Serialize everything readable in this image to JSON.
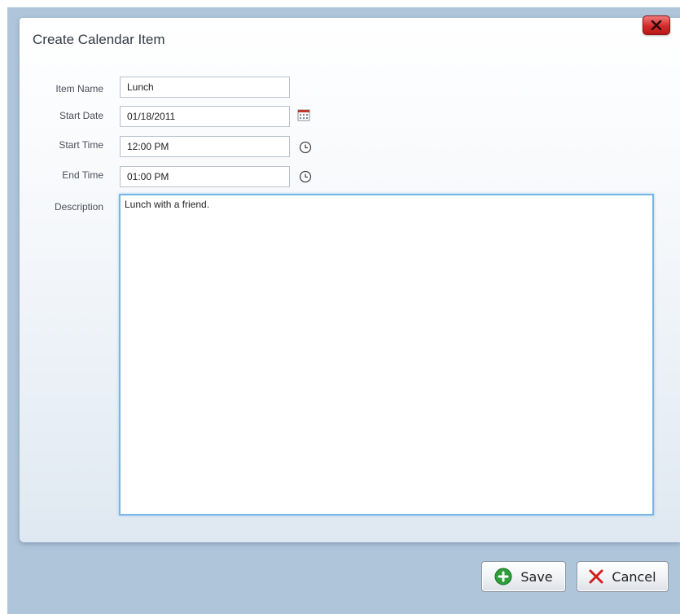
{
  "dialog": {
    "title": "Create Calendar Item"
  },
  "form": {
    "item_name": {
      "label": "Item Name",
      "value": "Lunch"
    },
    "start_date": {
      "label": "Start Date",
      "value": "01/18/2011"
    },
    "start_time": {
      "label": "Start Time",
      "value": "12:00 PM"
    },
    "end_time": {
      "label": "End Time",
      "value": "01:00 PM"
    },
    "description": {
      "label": "Description",
      "value": "Lunch with a friend."
    }
  },
  "footer": {
    "save_label": "Save",
    "cancel_label": "Cancel"
  },
  "colors": {
    "backdrop": "#aec5da",
    "focus_border": "#77b7e6",
    "close_red": "#d42a2a",
    "save_green": "#2e9d3a",
    "cancel_red": "#d21f1f"
  },
  "icons": {
    "close": "close-icon",
    "calendar": "calendar-icon",
    "clock": "clock-icon",
    "save": "plus-circle-icon",
    "cancel": "x-icon"
  }
}
